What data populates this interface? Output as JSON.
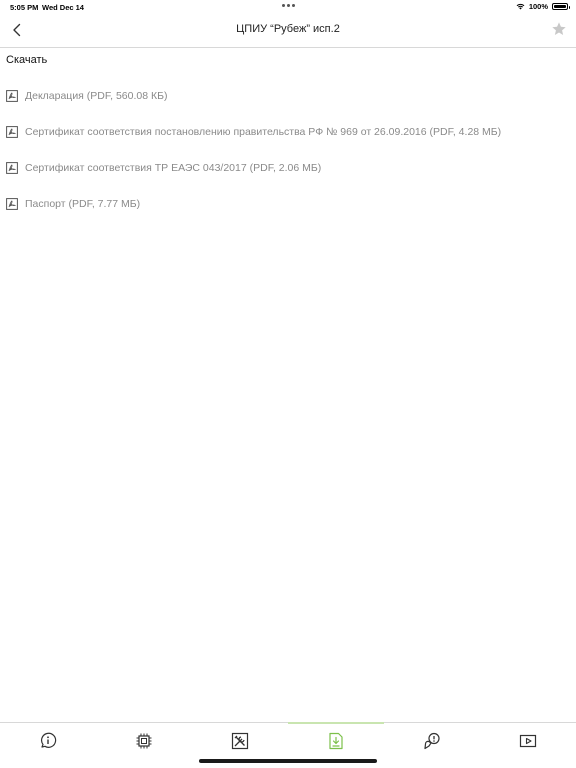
{
  "status_bar": {
    "time": "5:05 PM",
    "date": "Wed Dec 14",
    "battery": "100%",
    "wifi_icon": "wifi-icon"
  },
  "nav": {
    "title": "ЦПИУ “Рубеж” исп.2",
    "back_icon": "chevron-left-icon",
    "favorite_icon": "star-icon"
  },
  "section": {
    "title": "Скачать"
  },
  "documents": [
    {
      "label": "Декларация (PDF, 560.08 КБ)",
      "icon": "pdf-file-icon"
    },
    {
      "label": "Сертификат соответствия постановлению правительства РФ № 969 от 26.09.2016 (PDF, 4.28 МБ)",
      "icon": "pdf-file-icon"
    },
    {
      "label": "Сертификат соответствия ТР ЕАЭС 043/2017 (PDF, 2.06 МБ)",
      "icon": "pdf-file-icon"
    },
    {
      "label": "Паспорт (PDF, 7.77 МБ)",
      "icon": "pdf-file-icon"
    }
  ],
  "tabs": [
    {
      "id": "info",
      "icon": "info-icon",
      "active": false
    },
    {
      "id": "specs",
      "icon": "chip-icon",
      "active": false
    },
    {
      "id": "install",
      "icon": "tools-icon",
      "active": false
    },
    {
      "id": "downloads",
      "icon": "download-file-icon",
      "active": true
    },
    {
      "id": "faq",
      "icon": "support-icon",
      "active": false
    },
    {
      "id": "video",
      "icon": "play-video-icon",
      "active": false
    }
  ],
  "colors": {
    "active_tab": "#7cc04a",
    "inactive_tab": "#333333",
    "doc_text": "#8a8a8a",
    "star": "#c8c8c8"
  }
}
